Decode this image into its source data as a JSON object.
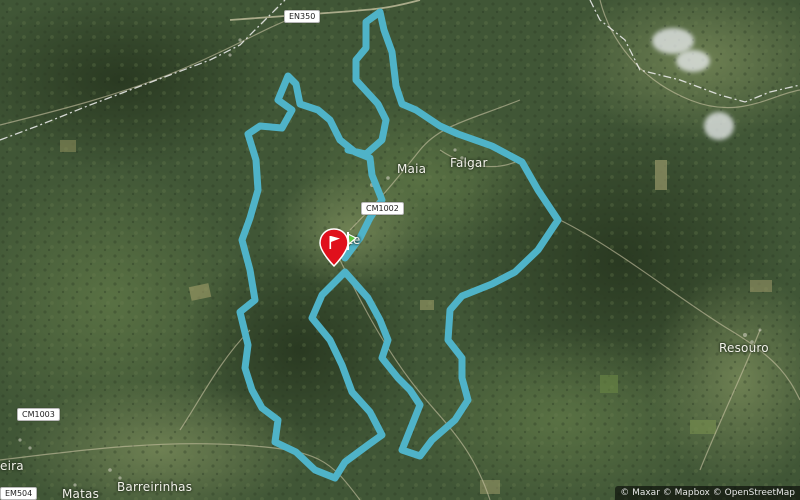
{
  "map": {
    "place_labels": [
      {
        "id": "maia",
        "text": "Maia"
      },
      {
        "id": "falgar",
        "text": "Falgar"
      },
      {
        "id": "resouro",
        "text": "Resouro"
      },
      {
        "id": "barreirinhas",
        "text": "Barreirinhas"
      },
      {
        "id": "matas",
        "text": "Matas"
      },
      {
        "id": "eira",
        "text": "eira"
      },
      {
        "id": "te",
        "text": "te"
      }
    ],
    "road_shields": [
      {
        "id": "en350",
        "text": "EN350"
      },
      {
        "id": "cm1002",
        "text": "CM1002"
      },
      {
        "id": "cm1003",
        "text": "CM1003"
      },
      {
        "id": "em504",
        "text": "EM504"
      }
    ],
    "route": {
      "color": "#4fb3c8",
      "type": "loop"
    },
    "markers": {
      "flag_pin_color": "#e0101c",
      "start_color": "#5cc440"
    },
    "attribution": "© Maxar © Mapbox © OpenStreetMap"
  }
}
